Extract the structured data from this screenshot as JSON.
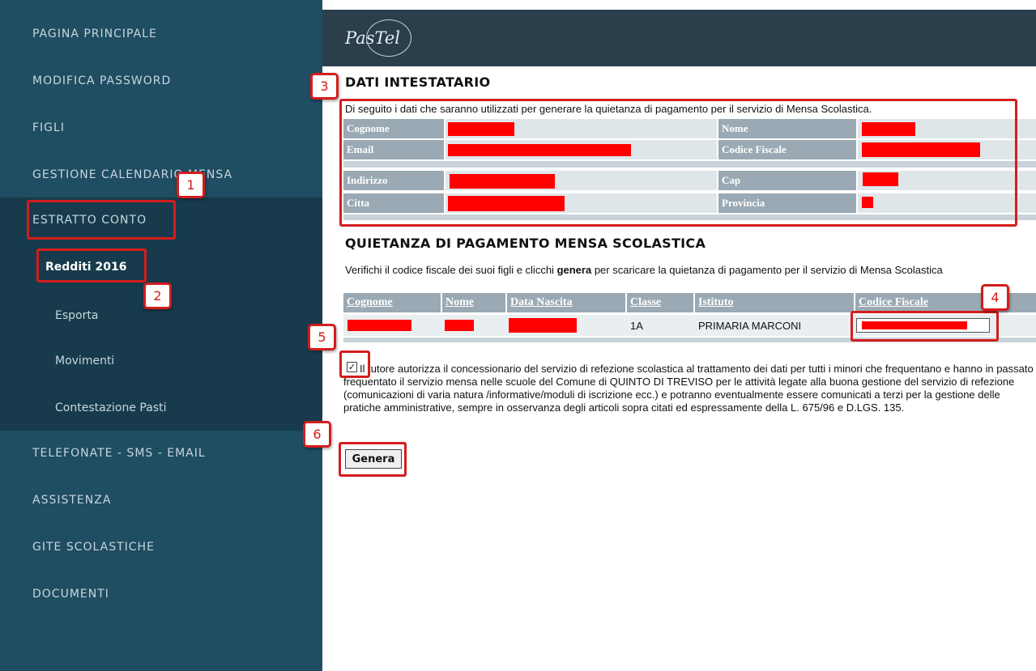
{
  "sidebar": {
    "items": [
      {
        "label": "PAGINA PRINCIPALE"
      },
      {
        "label": "MODIFICA PASSWORD"
      },
      {
        "label": "FIGLI"
      },
      {
        "label": "GESTIONE CALENDARIO MENSA"
      },
      {
        "label": "ESTRATTO CONTO"
      },
      {
        "label": "TELEFONATE - SMS - EMAIL"
      },
      {
        "label": "ASSISTENZA"
      },
      {
        "label": "GITE SCOLASTICHE"
      },
      {
        "label": "DOCUMENTI"
      }
    ],
    "subitems": [
      {
        "label": "Redditi 2016"
      },
      {
        "label": "Esporta"
      },
      {
        "label": "Movimenti"
      },
      {
        "label": "Contestazione Pasti"
      }
    ]
  },
  "header": {
    "logo_text": "PasTel"
  },
  "dati_intestatario": {
    "title": "DATI INTESTATARIO",
    "description": "Di seguito i dati che saranno utilizzati per generare la quietanza di pagamento per il servizio di Mensa Scolastica.",
    "labels": {
      "cognome": "Cognome",
      "nome": "Nome",
      "email": "Email",
      "codice_fiscale": "Codice Fiscale",
      "indirizzo": "Indirizzo",
      "cap": "Cap",
      "citta": "Citta",
      "provincia": "Provincia"
    }
  },
  "quietanza": {
    "title": "QUIETANZA DI PAGAMENTO MENSA SCOLASTICA",
    "instruction_pre": "Verifichi il codice fiscale dei suoi figli e clicchi ",
    "instruction_bold": "genera",
    "instruction_post": " per scaricare la quietanza di pagamento per il servizio di Mensa Scolastica",
    "columns": [
      "Cognome",
      "Nome",
      "Data Nascita",
      "Classe",
      "Istituto",
      "Codice Fiscale"
    ],
    "row": {
      "classe": "1A",
      "istituto": "PRIMARIA MARCONI"
    }
  },
  "consent": {
    "checked": true,
    "text": "Il tutore autorizza il concessionario del servizio di refezione scolastica al trattamento dei dati per tutti i minori che frequentano e hanno in passato frequentato il servizio mensa nelle scuole del Comune di QUINTO DI TREVISO per le attività legate alla buona gestione del servizio di refezione (comunicazioni di varia natura /informative/moduli di iscrizione ecc.) e potranno eventualmente essere comunicati a terzi per la gestione delle pratiche amministrative, sempre in osservanza degli articoli sopra citati ed espressamente della L. 675/96 e D.LGS. 135."
  },
  "genera_button": {
    "label": "Genera"
  },
  "callouts": [
    "1",
    "2",
    "3",
    "4",
    "5",
    "6"
  ],
  "colors": {
    "sidebar_bg": "#1f4d62",
    "sidebar_sub_bg": "#173b4c",
    "header_bg": "#2b3e4c",
    "table_header": "#9aa9b3",
    "callout_red": "#d41d1d",
    "redaction": "#ff0000"
  }
}
